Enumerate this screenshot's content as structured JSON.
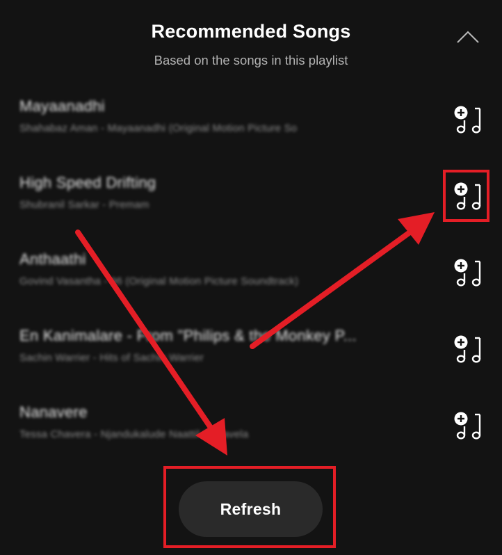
{
  "header": {
    "title": "Recommended Songs",
    "subtitle": "Based on the songs in this playlist",
    "collapse_icon": "chevron-up-icon"
  },
  "songs": [
    {
      "title": "Mayaanadhi",
      "subtitle": "Shahabaz Aman - Mayaanadhi (Original Motion Picture So"
    },
    {
      "title": "High Speed Drifting",
      "subtitle": "Shubranil Sarkar - Premam"
    },
    {
      "title": "Anthaathi",
      "subtitle": "Govind Vasantha - 96 (Original Motion Picture Soundtrack)"
    },
    {
      "title": "En Kanimalare - From \"Philips & the Monkey P...",
      "subtitle": "Sachin Warrier - Hits of Sachin Warrier"
    },
    {
      "title": "Nanavere",
      "subtitle": "Tessa Chavera - Njandukalude Naattil Oridavela"
    }
  ],
  "add_icon": "add-to-playlist-icon",
  "refresh": {
    "label": "Refresh"
  },
  "colors": {
    "background": "#131313",
    "annotation": "#e41e26",
    "button": "#2a2a2a"
  }
}
